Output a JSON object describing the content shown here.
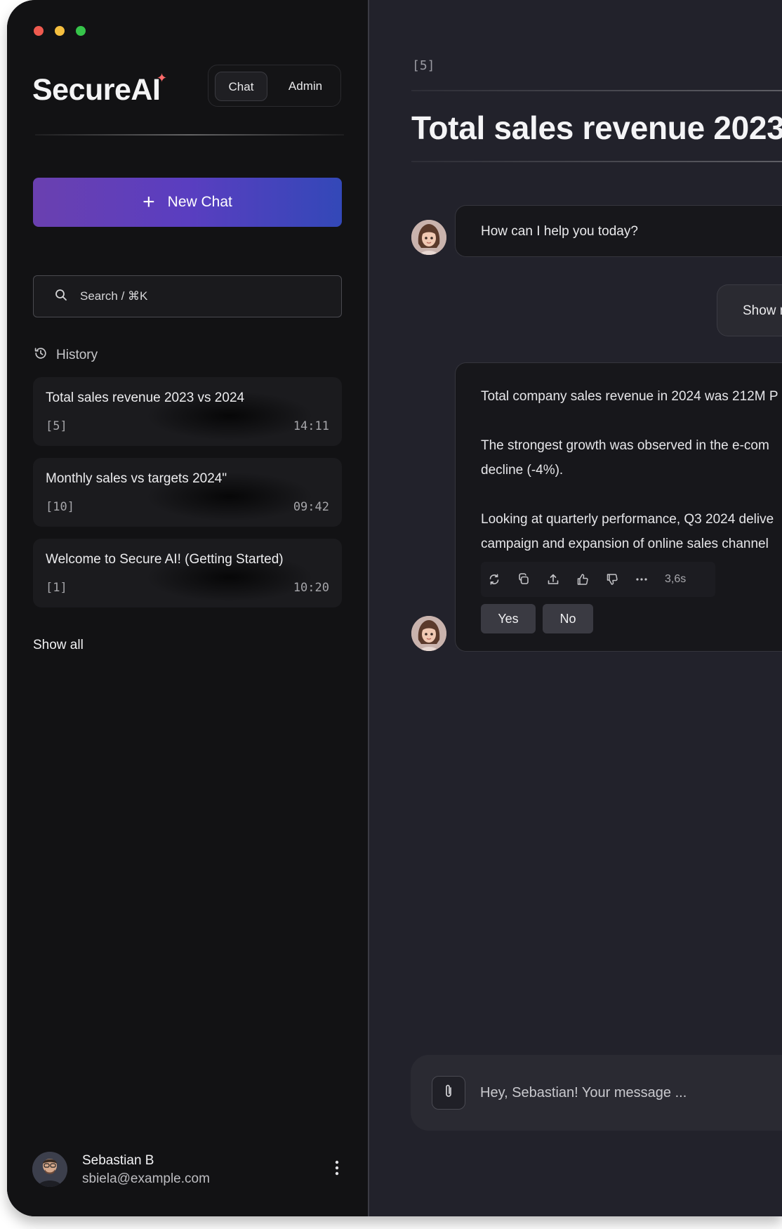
{
  "window": {
    "traffic_lights": [
      "#ef5a4f",
      "#f5bf3f",
      "#36c44a"
    ]
  },
  "sidebar": {
    "logo": "SecureAI",
    "mode_tabs": {
      "chat": "Chat",
      "admin": "Admin"
    },
    "new_chat_label": "New Chat",
    "search_placeholder": "Search / ⌘K",
    "history_label": "History",
    "history": [
      {
        "title": "Total sales revenue 2023 vs 2024",
        "count": "[5]",
        "time": "14:11"
      },
      {
        "title": "Monthly sales vs targets 2024\"",
        "count": "[10]",
        "time": "09:42"
      },
      {
        "title": "Welcome to Secure AI! (Getting Started)",
        "count": "[1]",
        "time": "10:20"
      }
    ],
    "show_all": "Show all",
    "user": {
      "name": "Sebastian B",
      "email": "sbiela@example.com"
    }
  },
  "main": {
    "breadcrumb": "[5]",
    "title": "Total sales revenue 2023",
    "greeting": "How can I help you today?",
    "user_message": "Show m",
    "answer": {
      "line1": "Total company sales revenue in 2024 was 212M P",
      "line2": "The strongest growth was observed in the e-com",
      "line3": "decline (-4%).",
      "line4": "Looking at quarterly performance, Q3 2024 delive",
      "line5": "campaign and expansion of online sales channel"
    },
    "response_time": "3,6s",
    "feedback": {
      "yes": "Yes",
      "no": "No"
    },
    "composer_placeholder": "Hey, Sebastian! Your message ..."
  },
  "colors": {
    "accent_gradient_start": "#6a40b0",
    "accent_gradient_end": "#3348b8",
    "logo_spark": "#ff6b6b"
  }
}
